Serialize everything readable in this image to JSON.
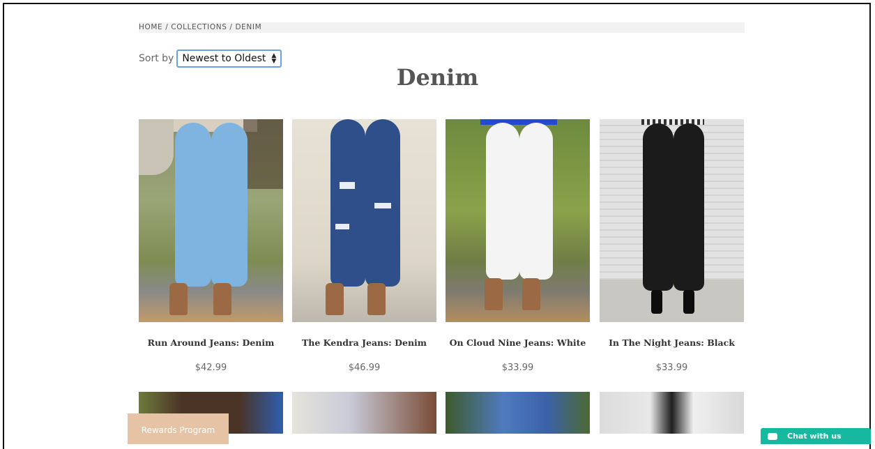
{
  "breadcrumb": {
    "home": "HOME",
    "collections": "COLLECTIONS",
    "current": "DENIM",
    "sep": "/"
  },
  "sort": {
    "label": "Sort by",
    "selected": "Newest to Oldest"
  },
  "page_title": "Denim",
  "products": [
    {
      "name": "Run Around Jeans: Denim",
      "price": "$42.99",
      "jean_color": "#7fb4e0"
    },
    {
      "name": "The Kendra Jeans: Denim",
      "price": "$46.99",
      "jean_color": "#2f4f8a"
    },
    {
      "name": "On Cloud Nine Jeans: White",
      "price": "$33.99",
      "jean_color": "#f4f4f4"
    },
    {
      "name": "In The Night Jeans: Black",
      "price": "$33.99",
      "jean_color": "#1b1b1b"
    }
  ],
  "rewards": {
    "label": "Rewards Program"
  },
  "chat": {
    "label": "Chat with us"
  },
  "colors": {
    "accent_chat": "#17b8a0",
    "rewards_bg": "#e6c3a5",
    "select_border": "#6aa0e6"
  }
}
